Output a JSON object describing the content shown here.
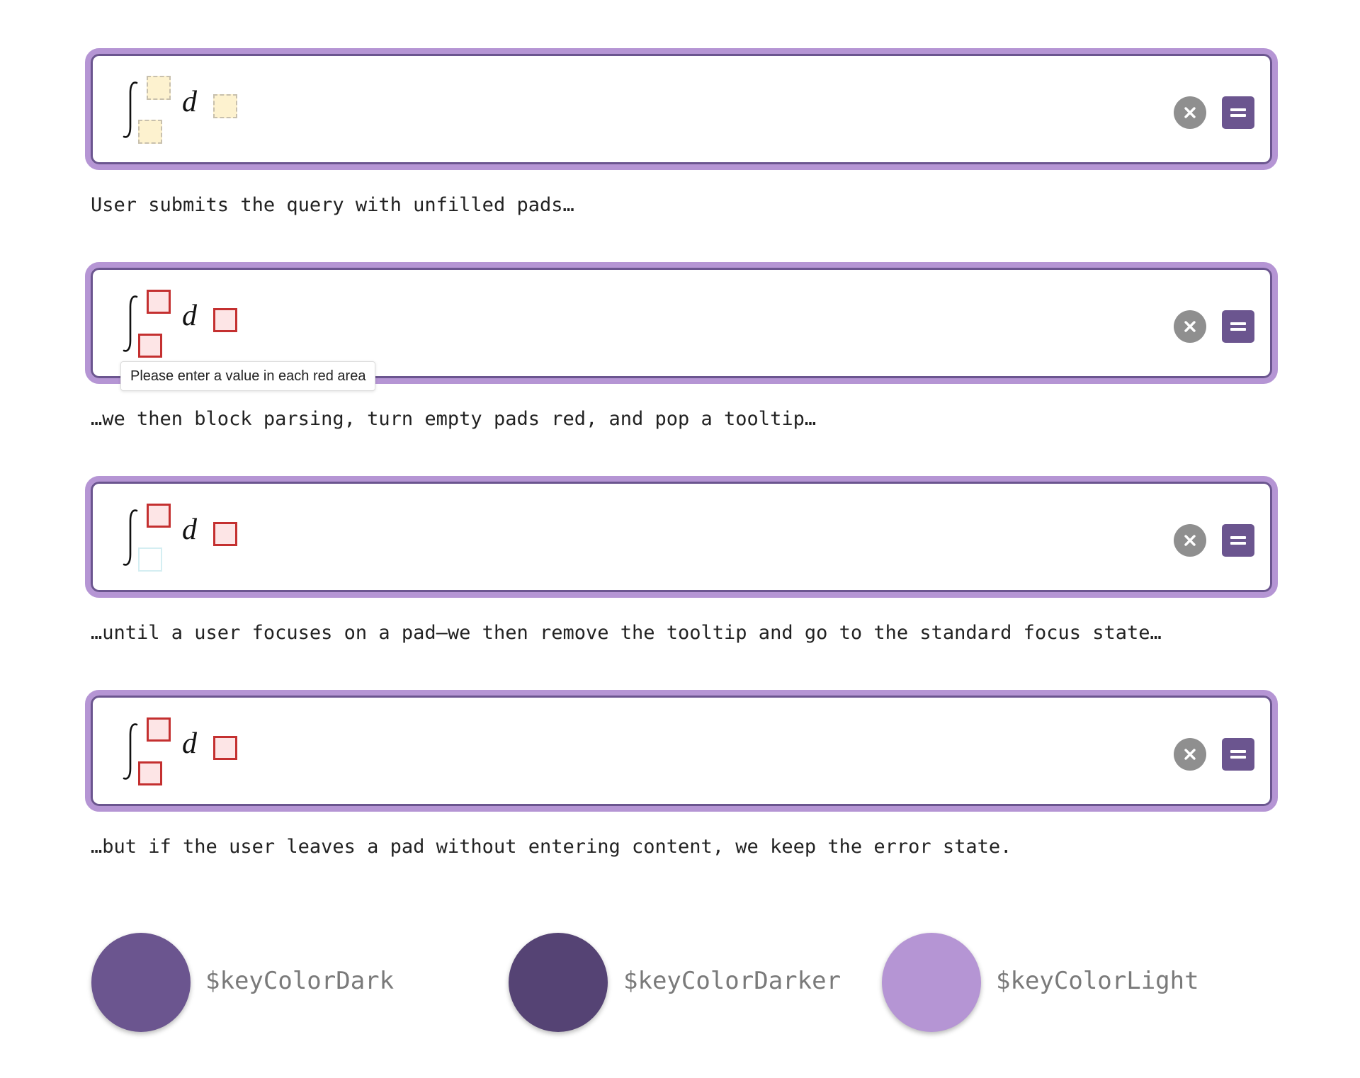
{
  "states": [
    {
      "caption": "User submits the query with unfilled pads…",
      "pad_state": "unfilled",
      "d_label": "d"
    },
    {
      "caption": "…we then block parsing, turn empty pads red, and pop a tooltip…",
      "pad_state": "error",
      "d_label": "d",
      "tooltip": "Please enter a value in each red area"
    },
    {
      "caption": "…until a user focuses on a pad—we then remove the tooltip and go to the standard focus state…",
      "pad_state": "error-with-focused-lower-pad",
      "d_label": "d"
    },
    {
      "caption": "…but if the user leaves a pad without entering content, we keep the error state.",
      "pad_state": "error",
      "d_label": "d"
    }
  ],
  "icons": {
    "integral": "integral-icon",
    "clear": "close-icon",
    "submit": "equals-icon"
  },
  "swatches": [
    {
      "label": "$keyColorDark",
      "color": "#6b558f"
    },
    {
      "label": "$keyColorDarker",
      "color": "#554374"
    },
    {
      "label": "$keyColorLight",
      "color": "#b595d4"
    }
  ],
  "colors": {
    "panel_border_outer": "#b595d4",
    "panel_border_inner": "#6b558f",
    "clear_button": "#8f8f8f",
    "submit_button": "#6b558f",
    "pad_unfilled_fill": "#fdf2cf",
    "pad_error_fill": "#fde5e6",
    "pad_error_border": "#c43030",
    "pad_focus_border": "#d4eef2"
  }
}
